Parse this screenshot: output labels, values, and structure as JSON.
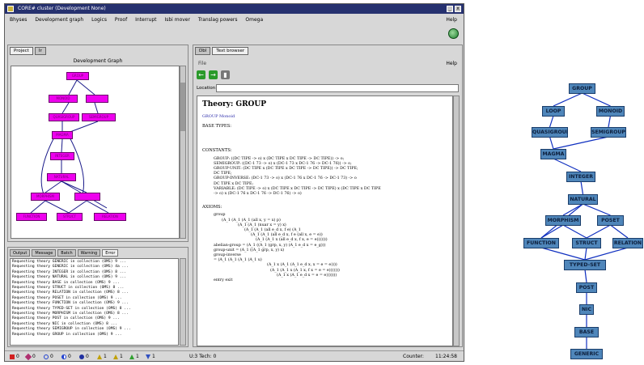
{
  "window": {
    "title": "CORE# cluster (Development None)"
  },
  "menu": [
    "Bhyses",
    "Development graph",
    "Logics",
    "Proof",
    "Interrupt",
    "Isbi mover",
    "Translag powers",
    "Omega"
  ],
  "menu_help": "Help",
  "left_tabs": [
    "Project",
    "Ir"
  ],
  "dg_title": "Development Graph",
  "dg_nodes": [
    "GROUP",
    "MONOID",
    "QUASIGROUP",
    "SEMIGROUP",
    "MAGMA",
    "INTEGER",
    "NATURAL",
    "MORPHISM",
    "FUNCTION",
    "STRUCT",
    "RELATION"
  ],
  "log_tabs": [
    "Output",
    "Message",
    "Batch",
    "Warning",
    "Error"
  ],
  "log_lines": [
    "Requesting theory GENERIC in collection (OMS) 9 ...",
    "Requesting theory GENERIC in collection (OMS) 4a ...",
    "Requesting theory INTEGER in collection (OMS) 8 ...",
    "Requesting theory NATURAL in collection (OMS) 9 ...",
    "Requesting theory BASE in collection (OMS) 9 ...",
    "Requesting theory STRUCT in collection (OMS) 8 ...",
    "Requesting theory RELATION in collection (OMS) 8 ...",
    "Requesting theory POSET in collection (OMS) 9 ...",
    "Requesting theory FUNCTION in collection (OMS) 9 ...",
    "Requesting theory TYPED-SET in collection (OMS) 8 ...",
    "Requesting theory MORPHISM in collection (OMS) 8 ...",
    "Requesting theory POST in collection (OMS) 9 ...",
    "Requesting theory NIC in collection (OMS) 8 ...",
    "Requesting theory SEMIGROUP in collection (OMS) 9 ...",
    "Requesting theory GROUP in collection (OMS) 9 ..."
  ],
  "status": [
    {
      "icon": "square-icon",
      "color": "#d22020",
      "text": "0"
    },
    {
      "icon": "diamond-icon",
      "color": "#b03070",
      "text": "0"
    },
    {
      "icon": "circle-icon",
      "color": "#2040d0",
      "text": "0"
    },
    {
      "icon": "half-circle-icon",
      "color": "#2040d0",
      "text": "0"
    },
    {
      "icon": "filled-circle-icon",
      "color": "#2030a0",
      "text": "0"
    },
    {
      "icon": "triangle-icon",
      "color": "#c0a000",
      "text": "1"
    },
    {
      "icon": "triangle-icon",
      "color": "#c0a000",
      "text": "1"
    },
    {
      "icon": "triangle-icon",
      "color": "#30a030",
      "text": "1"
    },
    {
      "icon": "down-triangle-icon",
      "color": "#3050c0",
      "text": "1"
    }
  ],
  "status_mid": "U:3   Tech: 0",
  "status_right": [
    "Counter:",
    "11:24:58"
  ],
  "right_tabs": [
    "Dbl",
    "Text browser"
  ],
  "right_file": "File",
  "right_help": "Help",
  "url_label": "Location:",
  "doc": {
    "title": "Theory: GROUP",
    "link": "GROUP Monoid",
    "basetypes": "BASE TYPES:",
    "constants": "CONSTANTS:",
    "const_lines": [
      "GROUP: ((DC TIPE -> o) x (DC TIPE x DC TIPE -> DC TIPE)) -> o;",
      "SEMIGROUP: ((DC-1 73 -> o) x (DC-1 73 x DC-1 76 -> DC-1 76)) -> o;",
      "GROUP-UNIT: (DC TIPE x (DC TIPE x DC TIPE -> DC TIPE)) -> DC TIPE;",
      "DC TIPE;",
      "GROUP-INVERSE: (DC-1 73 -> o) x (DC-1 76 x DC-1 76 -> DC-1 73) -> o",
      "DC TIPE x DC TIPE;",
      "VARIABLE: (DC TIPE -> o) x (DC TIPE x DC TIPE -> DC TIPE) x (DC TIPE x DC TIPE",
      "-> o) x (DC-1 76 x DC-1 76 -> DC-1 76) -> o)"
    ],
    "axioms": "AXIOMS:",
    "axiom_lines": [
      "group",
      "(A_1 (A_1 (A_1 (all x, y = x) p)",
      "(A_1 (A_1 (nuar x = y) x)",
      "(A_1 (A_1 (all e_d x, f e) (A_1",
      "(A_1 (A_1 (all e_d x, f e (all x, e = e))",
      "(A_1 (A_1 x (all e_d x, f x, e = e)))))))",
      "abelian-group = (A_1 ((A_1 (grp, x, y) (A_1 e_d x = e_g)))",
      "group-unit = (A_1 ((A_1 grp, x, y) x)",
      "group-inverse",
      "= (A_1 (A_1 (A_1 (A_1 u)",
      "(A_1 x (A_1 (A_1 e_d x, x = e = e))))",
      "(A_1 (A_1 x (A_1 x, f x = e = e)))))))",
      "(A_1 x (A_1 e_d x = e = e)))))))",
      "entry exit"
    ]
  },
  "hierarchy": {
    "nodes": [
      {
        "id": "GROUP",
        "label": "GROUP"
      },
      {
        "id": "LOOP",
        "label": "LOOP"
      },
      {
        "id": "MONOID",
        "label": "MONOID"
      },
      {
        "id": "QUASIGROUP",
        "label": "QUASIGROUP"
      },
      {
        "id": "SEMIGROUP",
        "label": "SEMIGROUP"
      },
      {
        "id": "MAGMA",
        "label": "MAGMA"
      },
      {
        "id": "INTEGER",
        "label": "INTEGER"
      },
      {
        "id": "NATURAL",
        "label": "NATURAL"
      },
      {
        "id": "MORPHISM",
        "label": "MORPHISM"
      },
      {
        "id": "POSET",
        "label": "POSET"
      },
      {
        "id": "FUNCTION",
        "label": "FUNCTION"
      },
      {
        "id": "STRUCT",
        "label": "STRUCT"
      },
      {
        "id": "RELATION",
        "label": "RELATION"
      },
      {
        "id": "TYPED-SET",
        "label": "TYPED-SET"
      },
      {
        "id": "POST",
        "label": "POST"
      },
      {
        "id": "NIC",
        "label": "NIC"
      },
      {
        "id": "BASE",
        "label": "BASE"
      },
      {
        "id": "GENERIC",
        "label": "GENERIC"
      }
    ]
  }
}
